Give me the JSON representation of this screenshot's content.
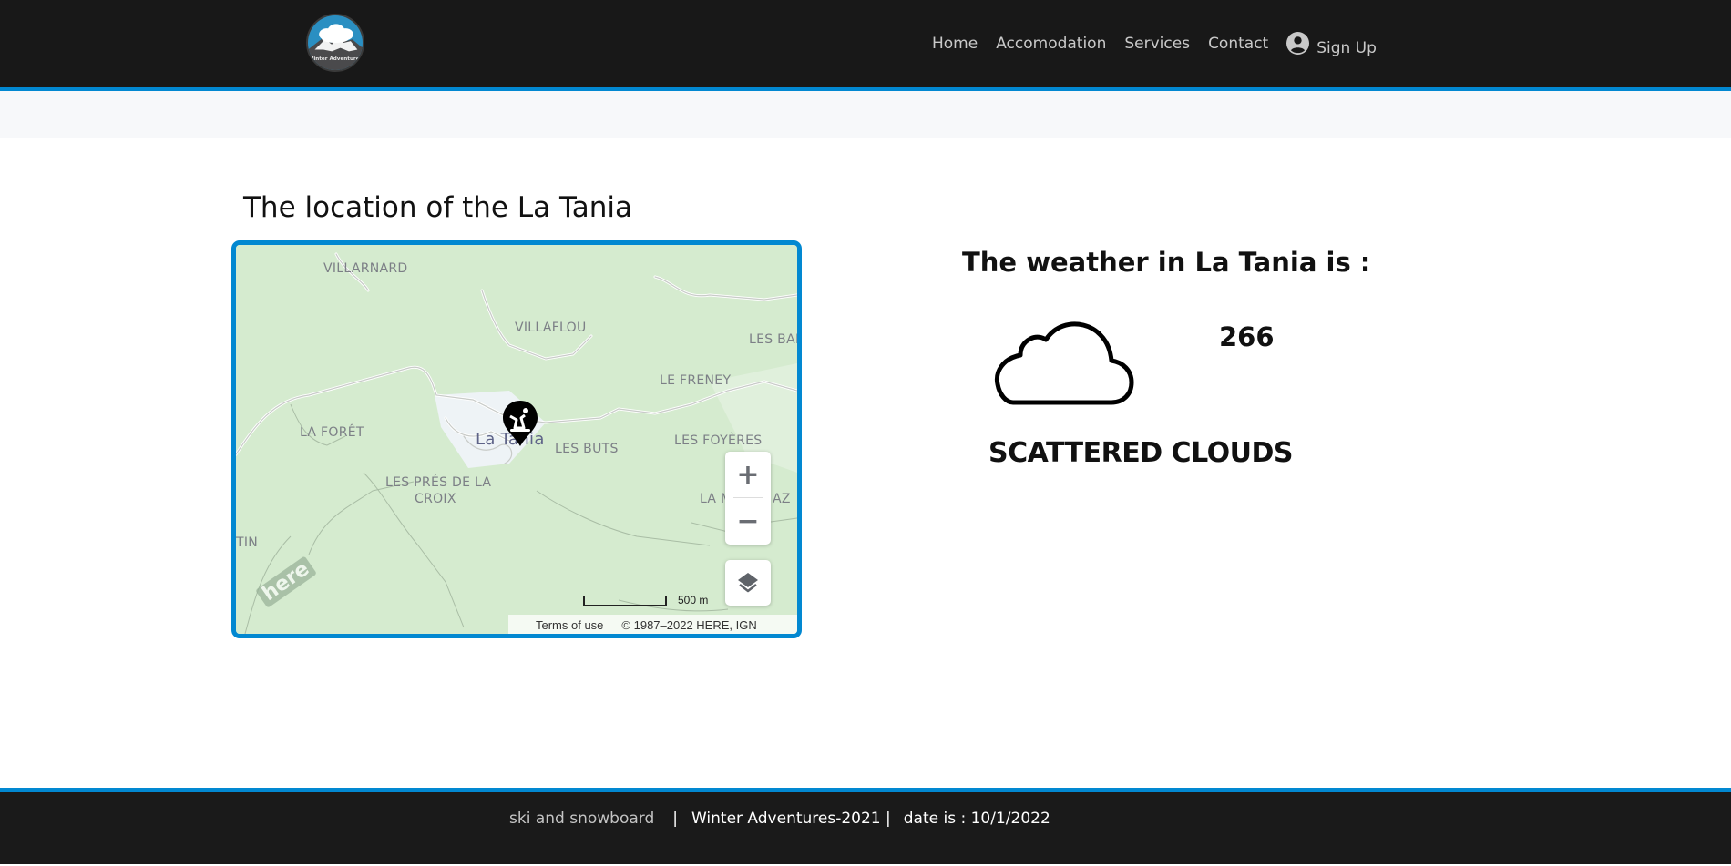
{
  "header": {
    "logo_alt": "Winter Adventures",
    "nav": [
      {
        "label": "Home"
      },
      {
        "label": "Accomodation"
      },
      {
        "label": "Services"
      },
      {
        "label": "Contact"
      }
    ],
    "signup_label": "Sign Up"
  },
  "colors": {
    "accent": "#0288d1",
    "header_bg": "#181818",
    "footer_bg": "#1a1a1a",
    "map_land": "#d5ebcf"
  },
  "location": {
    "title": "The location of the La Tania"
  },
  "map": {
    "places": [
      {
        "name": "VILLARNARD"
      },
      {
        "name": "VILLAFLOU"
      },
      {
        "name": "LES BAR"
      },
      {
        "name": "LE FRENEY"
      },
      {
        "name": "LA FORÊT"
      },
      {
        "name": "La Tania"
      },
      {
        "name": "LES BUTS"
      },
      {
        "name": "LES FOYÈRES"
      },
      {
        "name": "LES PRÉS DE LA"
      },
      {
        "name": "CROIX"
      },
      {
        "name": "LA M"
      },
      {
        "name": "AZ"
      },
      {
        "name": "TIN"
      }
    ],
    "marker_icon": "snowboard-pin-icon",
    "zoom_in": "+",
    "zoom_out": "−",
    "scale_label": "500 m",
    "terms_label": "Terms of use",
    "copyright": "© 1987–2022 HERE, IGN",
    "brand": "here"
  },
  "weather": {
    "prefix": "The weather in ",
    "city": "La Tania",
    "suffix": " is :",
    "icon": "cloud-icon",
    "value": "266",
    "description": "SCATTERED CLOUDS"
  },
  "footer": {
    "tagline": "ski and snowboard",
    "separator": "|",
    "brand": "Winter Adventures-2021 |",
    "date": "date is : 10/1/2022"
  }
}
